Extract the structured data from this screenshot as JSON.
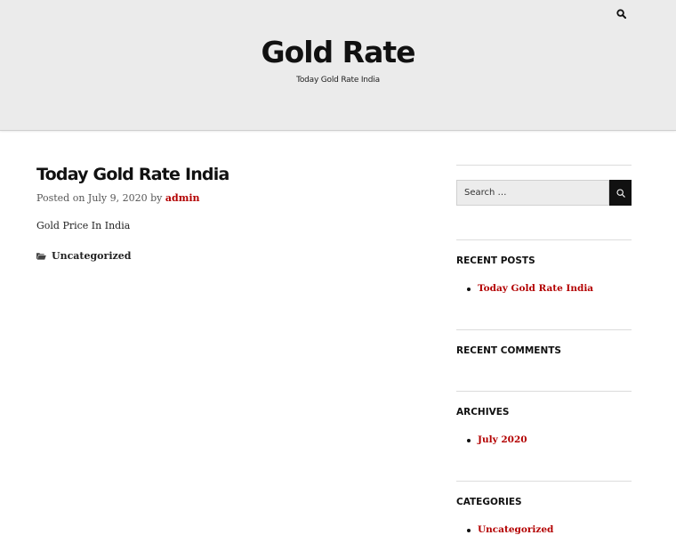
{
  "header": {
    "site_title": "Gold Rate",
    "site_description": "Today Gold Rate India"
  },
  "post": {
    "title": "Today Gold Rate India",
    "meta_prefix": "Posted on",
    "date": "July 9, 2020",
    "by": "by",
    "author": "admin",
    "content": "Gold Price In India",
    "category": "Uncategorized"
  },
  "sidebar": {
    "search_placeholder": "Search …",
    "recent_posts": {
      "title": "RECENT POSTS",
      "items": [
        "Today Gold Rate India"
      ]
    },
    "recent_comments": {
      "title": "RECENT COMMENTS"
    },
    "archives": {
      "title": "ARCHIVES",
      "items": [
        "July 2020"
      ]
    },
    "categories": {
      "title": "CATEGORIES",
      "items": [
        "Uncategorized"
      ]
    }
  },
  "colors": {
    "link": "#b30000",
    "header_bg": "#ebebeb",
    "text": "#111111"
  },
  "icons": {
    "header_search": "search-icon",
    "sidebar_search": "search-icon",
    "category": "folder-icon"
  }
}
